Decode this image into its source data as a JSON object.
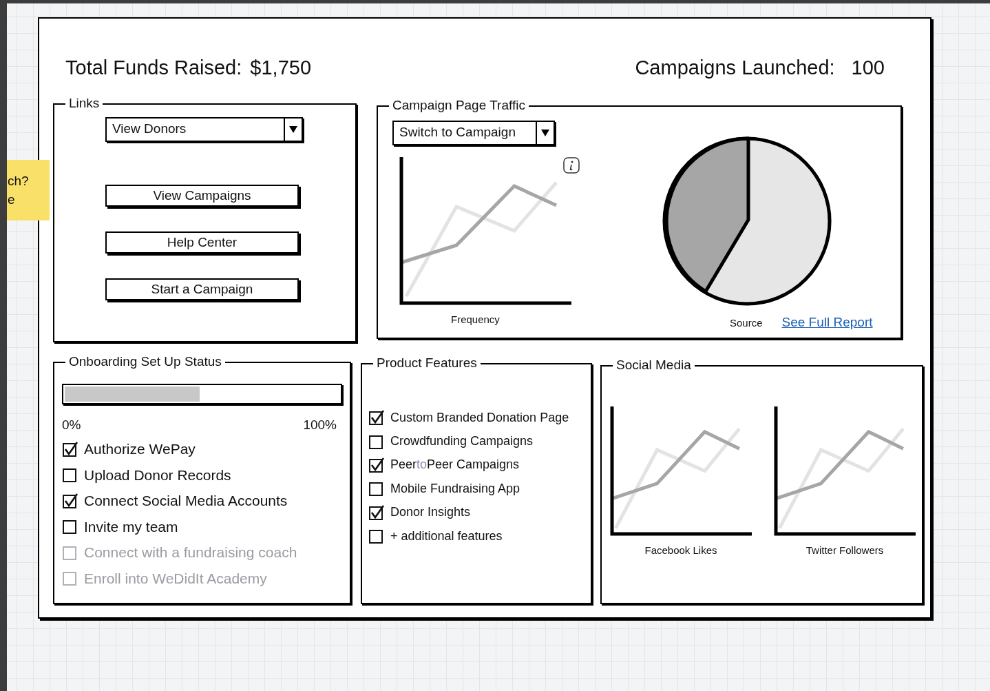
{
  "sticky_note": {
    "lines": [
      "ch?",
      "e"
    ]
  },
  "header": {
    "total_funds_label": "Total Funds Raised:",
    "total_funds_value": "$1,750",
    "campaigns_label": "Campaigns Launched:",
    "campaigns_value": "100"
  },
  "links": {
    "title": "Links",
    "dropdown": {
      "value": "View Donors"
    },
    "buttons": [
      "View Campaigns",
      "Help Center",
      "Start a Campaign"
    ]
  },
  "traffic": {
    "title": "Campaign Page Traffic",
    "dropdown": {
      "value": "Switch to Campaign"
    },
    "line_chart": {
      "label": "Frequency"
    },
    "pie_chart": {
      "label": "Source"
    },
    "link": "See Full Report"
  },
  "onboarding": {
    "title": "Onboarding Set Up Status",
    "progress": {
      "level": 0.49,
      "min_label": "0%",
      "max_label": "100%"
    },
    "tasks": [
      {
        "label": "Authorize WePay",
        "checked": true,
        "disabled": false
      },
      {
        "label": "Upload Donor Records",
        "checked": false,
        "disabled": false
      },
      {
        "label": "Connect Social Media Accounts",
        "checked": true,
        "disabled": false
      },
      {
        "label": "Invite my team",
        "checked": false,
        "disabled": false
      },
      {
        "label": "Connect with a fundraising coach",
        "checked": false,
        "disabled": true
      },
      {
        "label": "Enroll into WeDidIt Academy",
        "checked": false,
        "disabled": true
      }
    ]
  },
  "product_features": {
    "title": "Product Features",
    "items": [
      {
        "segments": [
          {
            "text": "Custom Branded Donation Page",
            "muted": false
          }
        ],
        "checked": true
      },
      {
        "segments": [
          {
            "text": "Crowdfunding Campaigns",
            "muted": false
          }
        ],
        "checked": false
      },
      {
        "segments": [
          {
            "text": "Peer",
            "muted": false
          },
          {
            "text": "to",
            "muted": true
          },
          {
            "text": "Peer Campaigns",
            "muted": false
          }
        ],
        "checked": true
      },
      {
        "segments": [
          {
            "text": "Mobile Fundraising App",
            "muted": false
          }
        ],
        "checked": false
      },
      {
        "segments": [
          {
            "text": "Donor Insights",
            "muted": false
          }
        ],
        "checked": true
      },
      {
        "segments": [
          {
            "text": "+ additional features",
            "muted": false
          }
        ],
        "checked": false
      }
    ]
  },
  "social_media": {
    "title": "Social Media",
    "charts": [
      {
        "label": "Facebook Likes"
      },
      {
        "label": "Twitter Followers"
      }
    ]
  }
}
